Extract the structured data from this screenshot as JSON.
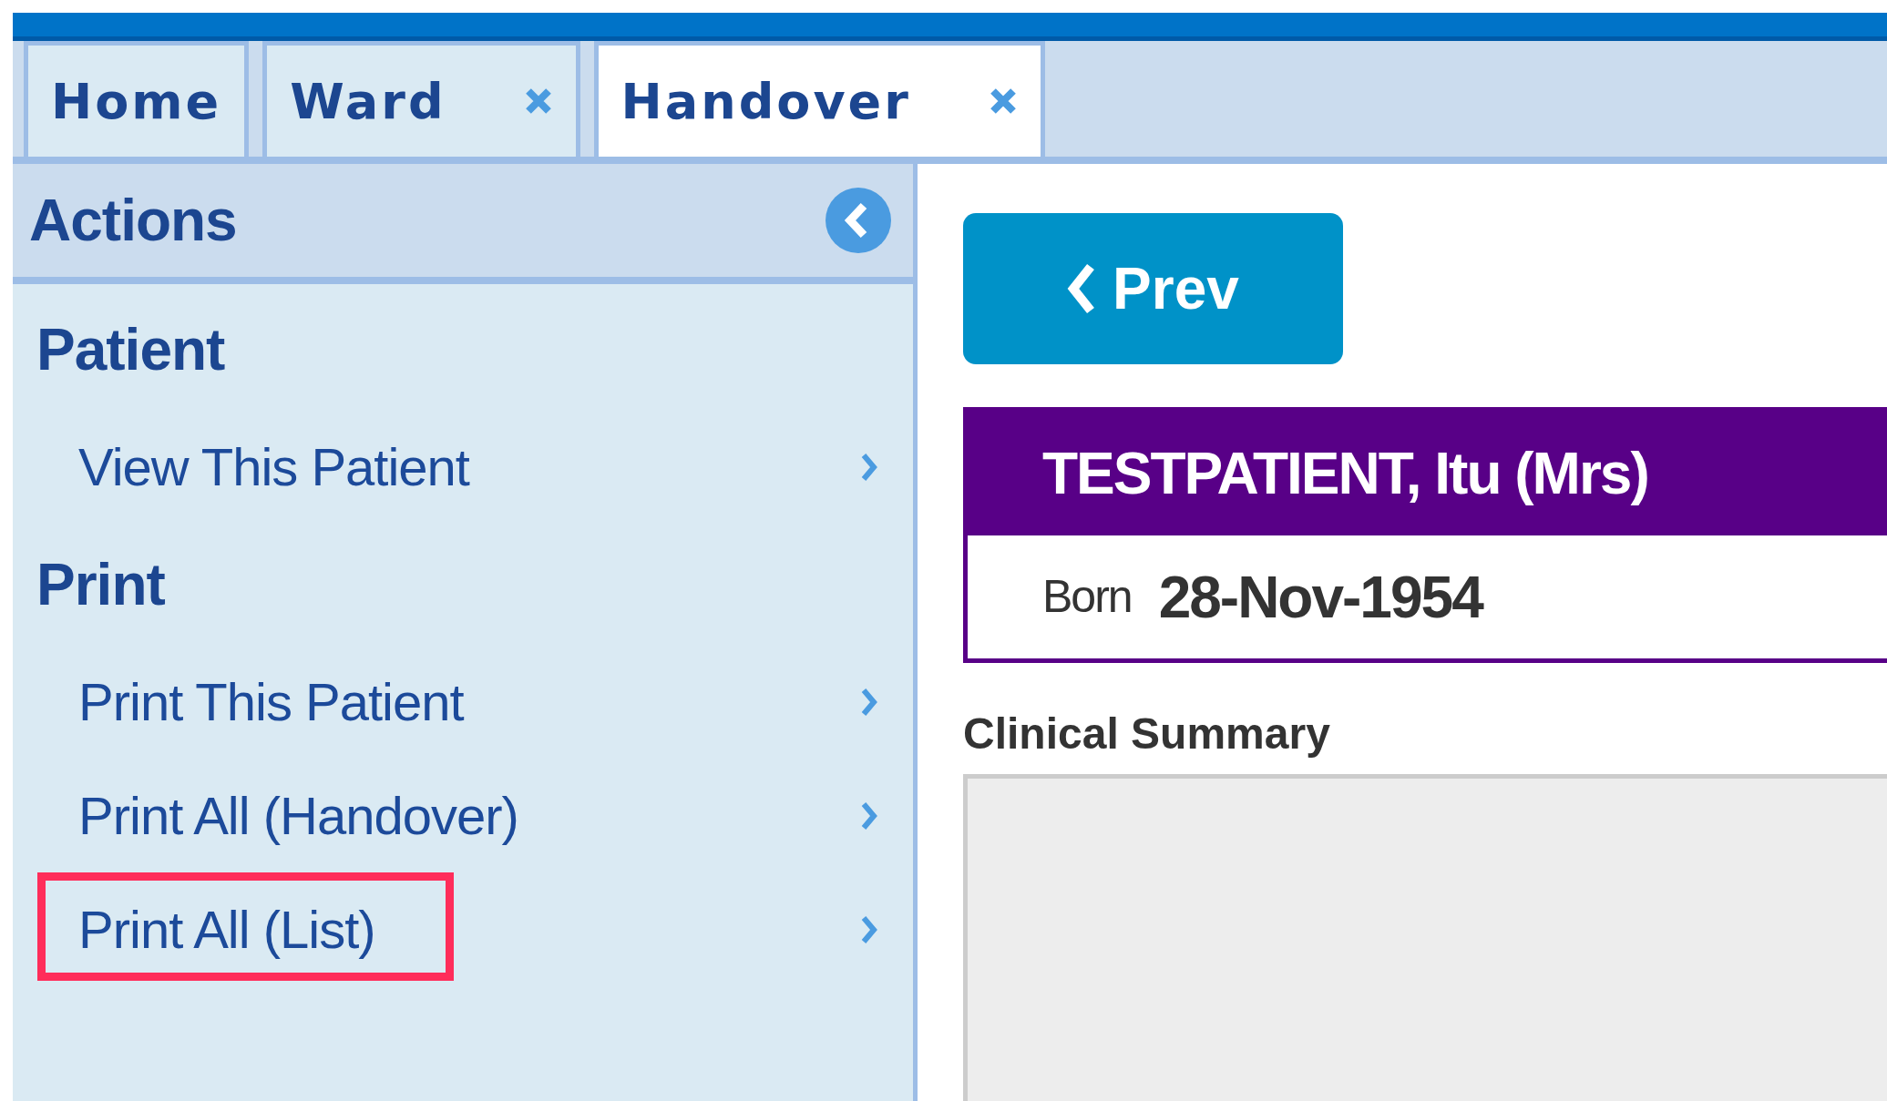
{
  "tabs": [
    {
      "label": "Home",
      "closable": false,
      "selected": false
    },
    {
      "label": "Ward",
      "closable": true,
      "selected": false
    },
    {
      "label": "Handover",
      "closable": true,
      "selected": true
    }
  ],
  "sidebar": {
    "title": "Actions",
    "sections": [
      {
        "heading": "Patient",
        "items": [
          {
            "label": "View This Patient",
            "highlighted": false
          }
        ]
      },
      {
        "heading": "Print",
        "items": [
          {
            "label": "Print This Patient",
            "highlighted": false
          },
          {
            "label": "Print All (Handover)",
            "highlighted": false
          },
          {
            "label": "Print All (List)",
            "highlighted": true
          }
        ]
      }
    ]
  },
  "prev_button": {
    "label": "Prev"
  },
  "patient": {
    "name": "TESTPATIENT, Itu (Mrs)",
    "born_label": "Born",
    "born_value": "28-Nov-1954"
  },
  "clinical_summary": {
    "label": "Clinical Summary"
  }
}
